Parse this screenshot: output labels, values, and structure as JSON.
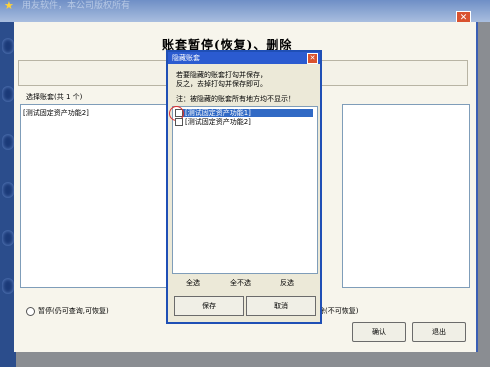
{
  "app": {
    "title_ghost": "用友软件，本公司版权所有"
  },
  "main": {
    "title": "账套暂停(恢复)、删除",
    "list_header": "选择账套(共 1 个)",
    "left_items": [
      "[测试固定资产功能2]"
    ],
    "radio_pause": "暂停(仍可查询,可恢复)",
    "radio_delete_tail": "除(不可恢复)",
    "confirm_label": "确认",
    "exit_label": "退出"
  },
  "dialog": {
    "title": "隐藏账套",
    "line1": "若要隐藏的账套打勾并保存，",
    "line2": "反之，去掉打勾并保存即可。",
    "line3": "注：被隐藏的账套所有地方均不显示！",
    "items": [
      "[测试固定资产功能1]",
      "[测试固定资产功能2]"
    ],
    "select_all": "全选",
    "select_none": "全不选",
    "invert": "反选",
    "save": "保存",
    "cancel": "取消"
  },
  "colors": {
    "titlebar": "#2b5bd0",
    "selection": "#316ac5",
    "window_bg": "#f7f5ec",
    "highlight_ring": "#e03030"
  }
}
